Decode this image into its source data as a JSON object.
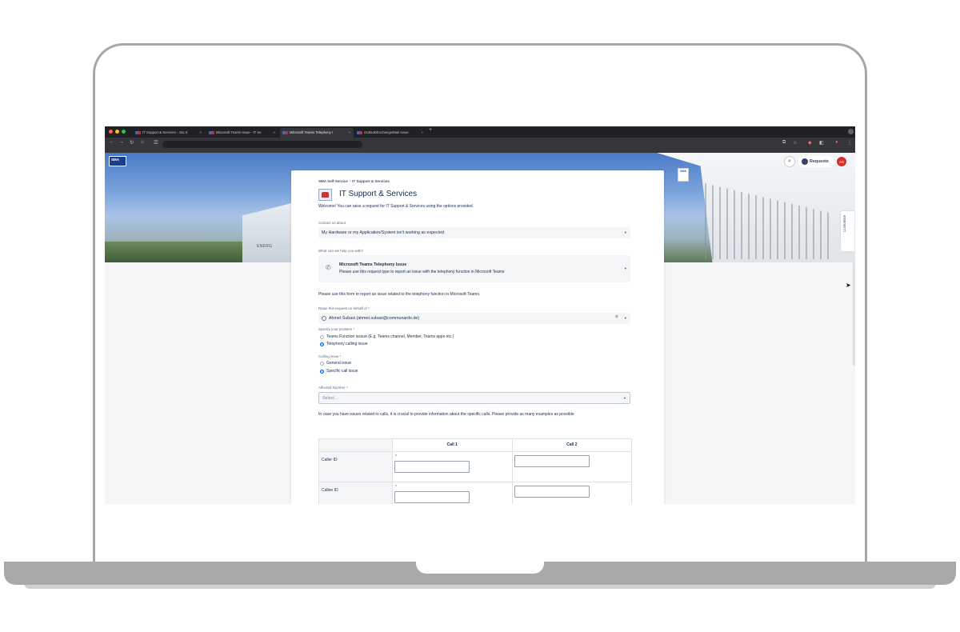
{
  "browser": {
    "tabs": [
      {
        "label": "IT Support & Services - Jira S",
        "active": false
      },
      {
        "label": "Microsoft Teams Issue - IT Se",
        "active": false
      },
      {
        "label": "Microsoft Teams Telephony I",
        "active": true
      },
      {
        "label": "Outlook/Exchange/Mail Issue",
        "active": false
      }
    ],
    "new_tab": "+",
    "close_glyph": "×"
  },
  "header": {
    "logo_text": "SMA",
    "requests_label": "Requests",
    "avatar_initials": "AS",
    "customise_label": "Customise",
    "hero_sign": "ENERG",
    "building_logo": "SMA"
  },
  "form": {
    "breadcrumb": [
      "SMA Self-Service",
      "IT Support & Services"
    ],
    "breadcrumb_sep": "/",
    "title": "IT Support & Services",
    "welcome": "Welcome! You can raise a request for IT Support & Services using the options provided.",
    "contact_label": "Contact us about",
    "contact_value": "My Hardware or my Application/System isn't working as expected",
    "help_label": "What can we help you with?",
    "request_type_title": "Microsoft Teams Telephony Issue",
    "request_type_desc": "Please use this request type to report an issue with the telephony function in Microsoft Teams",
    "intro": "Please use this form to report an issue related to the telephony function in Microsoft Teams.",
    "behalf_label": "Raise this request on behalf of *",
    "behalf_value": "Ahmet Subasi (ahmet.subasi@communardo.de)",
    "problem_label": "Specify your problem *",
    "problem_options": [
      {
        "label": "Teams Function isssue (E.g. Teams channel, Member, Teams apps etc.)",
        "checked": false
      },
      {
        "label": "Telephony calling issue",
        "checked": true
      }
    ],
    "calling_label": "Calling issue *",
    "calling_options": [
      {
        "label": "General issue",
        "checked": false
      },
      {
        "label": "Specific call issue",
        "checked": true
      }
    ],
    "affected_label": "Affected Number *",
    "affected_placeholder": "Select...",
    "calls_note": "In case you have issues related to calls, it is crucial to provide information about the specific calls. Please provide as many examples as possible",
    "table": {
      "columns": [
        "",
        "Call 1",
        "Call 2"
      ],
      "rows": [
        "Caller ID",
        "Callee ID"
      ],
      "required_mark": "*"
    },
    "chevron": "▾"
  }
}
